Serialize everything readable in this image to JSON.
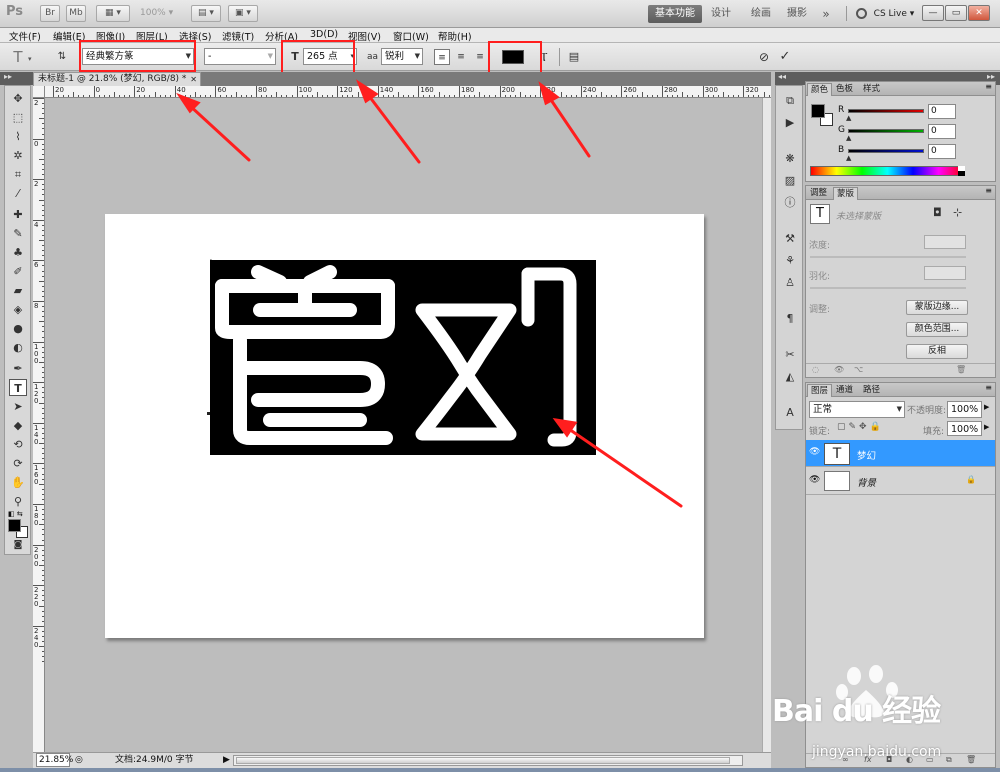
{
  "app": {
    "logo": "Ps",
    "zoom_select": "100%",
    "workspaces": [
      "基本功能",
      "设计",
      "绘画",
      "摄影"
    ],
    "workspace_more": "»",
    "cs_live": "CS Live",
    "window_buttons": [
      "—",
      "▭",
      "✕"
    ]
  },
  "menu": [
    "文件(F)",
    "编辑(E)",
    "图像(I)",
    "图层(L)",
    "选择(S)",
    "滤镜(T)",
    "分析(A)",
    "3D(D)",
    "视图(V)",
    "窗口(W)",
    "帮助(H)"
  ],
  "options": {
    "tool_glyph": "T",
    "font_family": "经典繁方篆",
    "font_style": "-",
    "font_size": "265 点",
    "antialias_label": "aa",
    "antialias": "锐利",
    "text_color": "#000000"
  },
  "document": {
    "tab_title": "未标题-1 @ 21.8% (梦幻, RGB/8) *",
    "seal_text": "梦幻",
    "ruler_h": [
      "20",
      "0",
      "20",
      "40",
      "60",
      "80",
      "100",
      "120",
      "140",
      "160",
      "180",
      "200",
      "220",
      "240",
      "260",
      "280",
      "300",
      "320"
    ],
    "ruler_v": [
      "2",
      "0",
      "2",
      "4",
      "6",
      "8",
      "1 0 0",
      "1 2 0",
      "1 4 0",
      "1 6 0",
      "1 8 0",
      "2 0 0",
      "2 2 0",
      "2 4 0"
    ]
  },
  "status": {
    "zoom": "21.85%",
    "doc_size": "文档:24.9M/0 字节"
  },
  "color_panel": {
    "tabs": [
      "颜色",
      "色板",
      "样式"
    ],
    "channels": [
      {
        "label": "R",
        "value": "0",
        "color": "#e00000"
      },
      {
        "label": "G",
        "value": "0",
        "color": "#00b000"
      },
      {
        "label": "B",
        "value": "0",
        "color": "#0010d0"
      }
    ]
  },
  "masks_panel": {
    "tabs": [
      "调整",
      "蒙版"
    ],
    "no_selection": "未选择蒙版",
    "density_label": "浓度:",
    "feather_label": "羽化:",
    "refine_label": "调整:",
    "buttons": [
      "蒙版边缘...",
      "颜色范围...",
      "反相"
    ]
  },
  "layers_panel": {
    "tabs": [
      "图层",
      "通道",
      "路径"
    ],
    "blend_mode": "正常",
    "opacity_label": "不透明度:",
    "opacity": "100%",
    "lock_label": "锁定:",
    "fill_label": "填充:",
    "fill": "100%",
    "layers": [
      {
        "name": "梦幻",
        "thumb": "T",
        "selected": true
      },
      {
        "name": "背景",
        "thumb": "",
        "selected": false
      }
    ]
  },
  "watermark": {
    "brand": "Bai du 经验",
    "url": "jingyan.baidu.com"
  },
  "colors": {
    "selection": "#3399ff",
    "annotation": "#ff1e1e"
  }
}
